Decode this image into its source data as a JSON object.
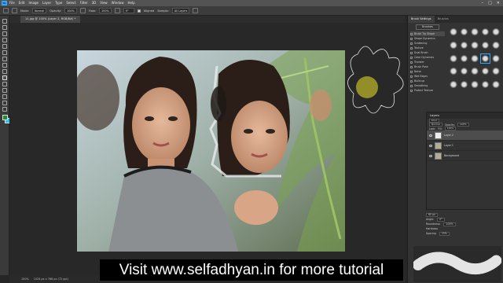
{
  "menubar": {
    "logo": "Ps",
    "items": [
      "File",
      "Edit",
      "Image",
      "Layer",
      "Type",
      "Select",
      "Filter",
      "3D",
      "View",
      "Window",
      "Help"
    ],
    "controls": [
      "–",
      "□",
      "✕"
    ]
  },
  "options": {
    "mode_label": "Mode:",
    "mode_value": "Normal",
    "opacity_label": "Opacity:",
    "opacity_value": "100%",
    "flow_label": "Flow:",
    "flow_value": "100%",
    "angle_value": "0°",
    "aligned_label": "Aligned",
    "sample_label": "Sample:",
    "sample_value": "All Layers"
  },
  "document": {
    "tab_title": "11.jpg @ 100% (Layer 2, RGB/8#) *",
    "zoom": "100%",
    "doc_info": "1024 px x 768 px (72 ppi)"
  },
  "brush_panel": {
    "tabs": [
      "Brush Settings",
      "Brushes"
    ],
    "brushes_button": "Brushes",
    "settings": [
      "Brush Tip Shape",
      "Shape Dynamics",
      "Scattering",
      "Texture",
      "Dual Brush",
      "Color Dynamics",
      "Transfer",
      "Brush Pose",
      "Noise",
      "Wet Edges",
      "Build-up",
      "Smoothing",
      "Protect Texture"
    ],
    "active_setting": "Brush Tip Shape",
    "size_value": "60 px",
    "angle_label": "Angle:",
    "angle_value": "0°",
    "roundness_label": "Roundness:",
    "roundness_value": "100%",
    "hardness_label": "Hardness",
    "spacing_label": "Spacing",
    "spacing_value": "25%"
  },
  "layers_panel": {
    "title": "Layers",
    "kind_label": "Kind",
    "blend_mode": "Normal",
    "opacity_label": "Opacity:",
    "opacity_value": "100%",
    "lock_label": "Lock:",
    "fill_label": "Fill:",
    "fill_value": "100%",
    "layers": [
      {
        "name": "Layer 2",
        "selected": true
      },
      {
        "name": "Layer 1",
        "selected": false
      },
      {
        "name": "Background",
        "selected": false
      }
    ]
  },
  "watermark": {
    "text": "Visit www.selfadhyan.in for more tutorial"
  }
}
